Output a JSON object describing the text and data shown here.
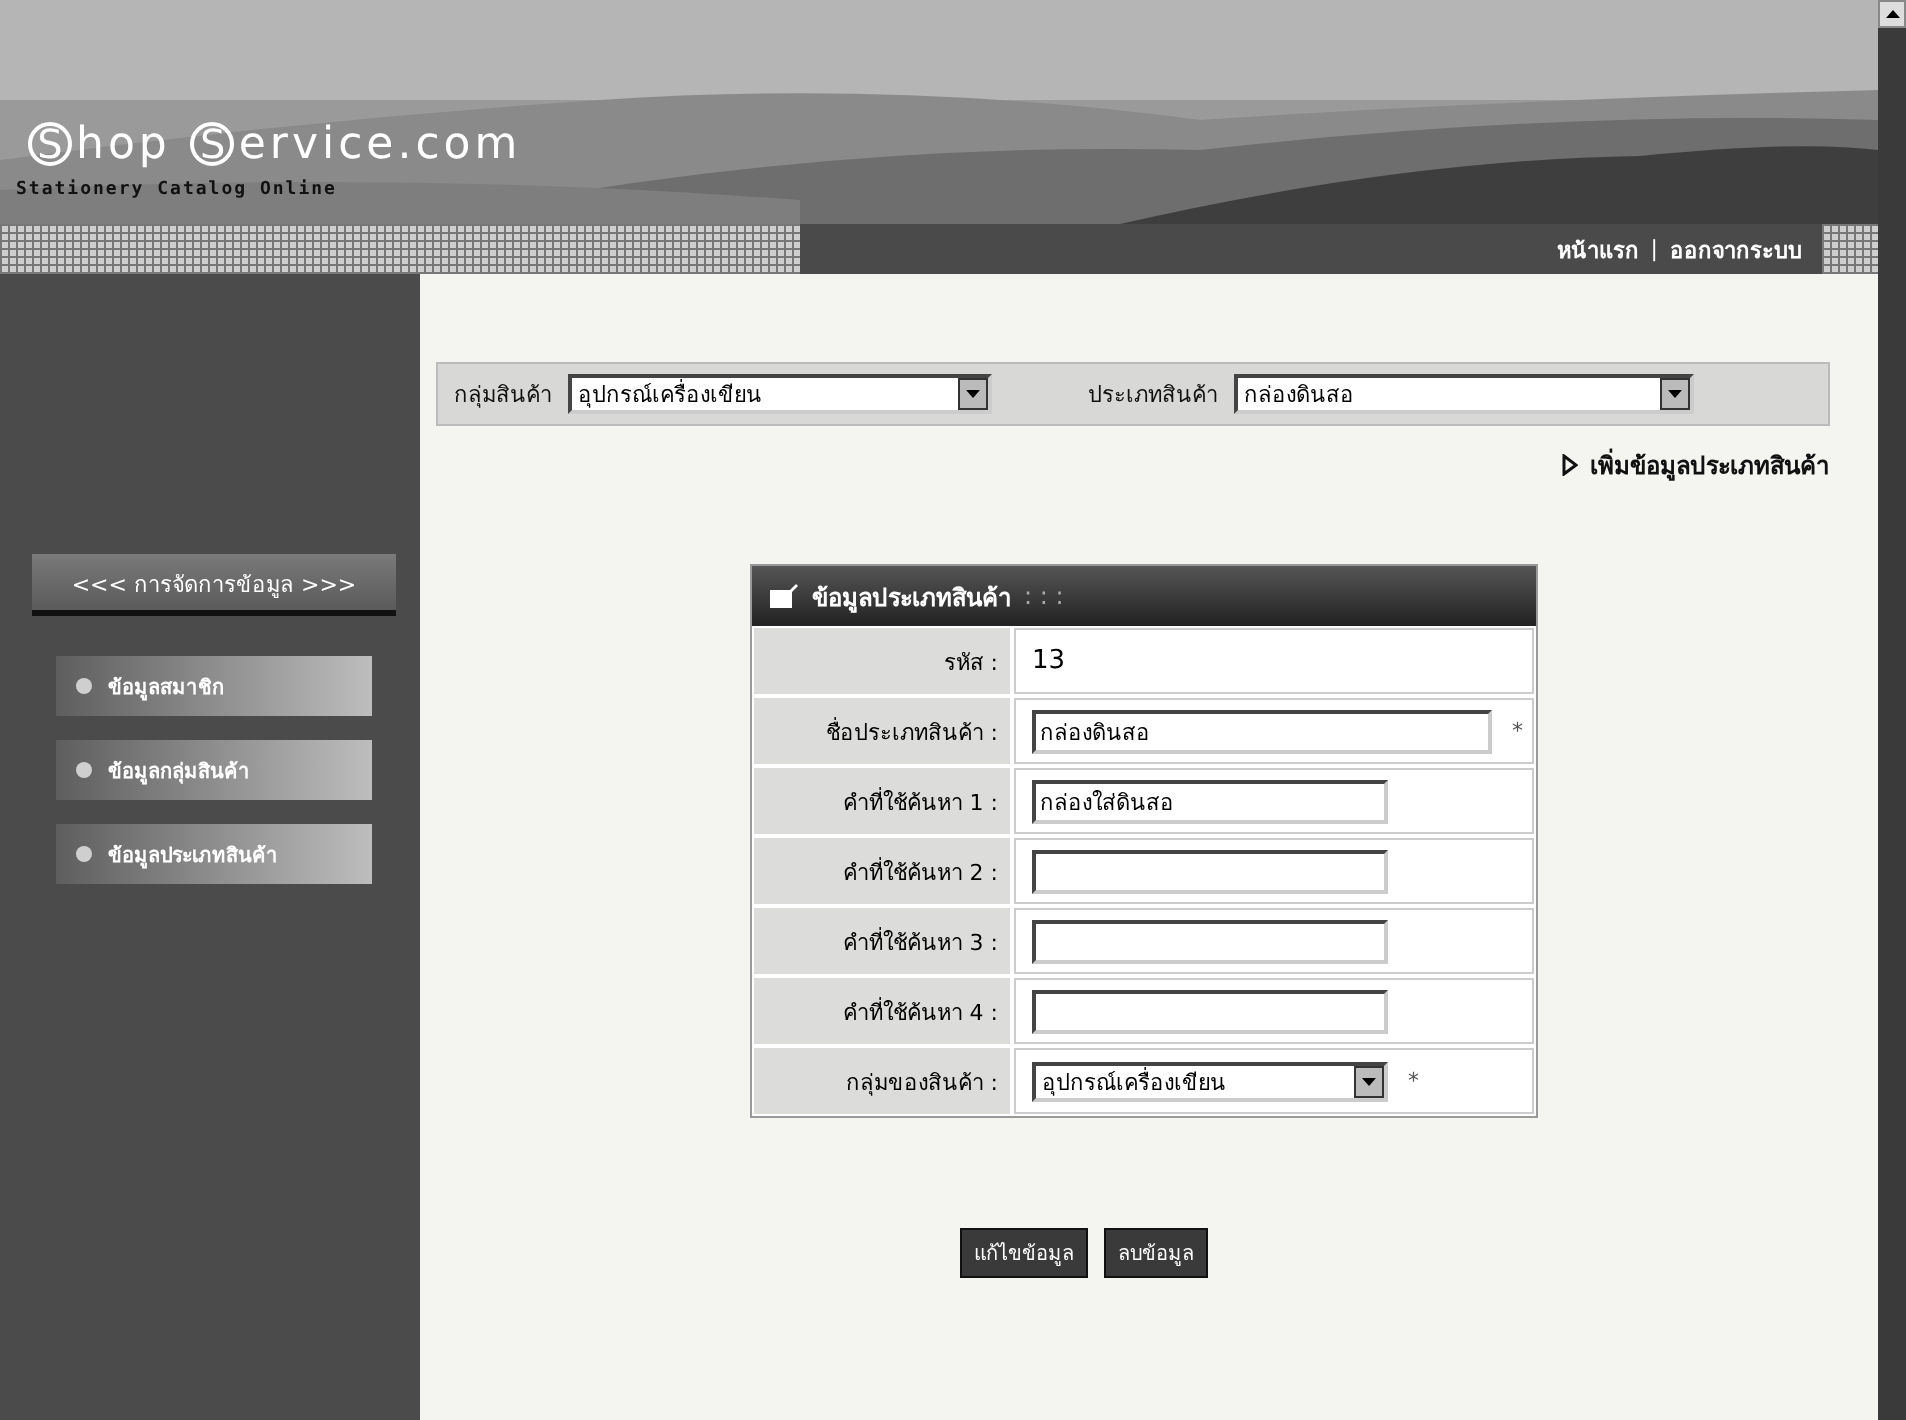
{
  "header": {
    "logo": [
      {
        "text": "S",
        "kind": "initial"
      },
      {
        "text": "hop",
        "kind": "rest"
      },
      {
        "text": "S",
        "kind": "initial"
      },
      {
        "text": "ervice.com",
        "kind": "rest"
      }
    ],
    "tagline": "Stationery Catalog Online",
    "nav_links": [
      "หน้าแรก",
      "ออกจากระบบ"
    ],
    "nav_separator": "|"
  },
  "sidebar": {
    "title": "<<< การจัดการข้อมูล >>>",
    "items": [
      {
        "label": "ข้อมูลสมาชิก"
      },
      {
        "label": "ข้อมูลกลุ่มสินค้า"
      },
      {
        "label": "ข้อมูลประเภทสินค้า"
      }
    ]
  },
  "filter_bar": {
    "filters": [
      {
        "label": "กลุ่มสินค้า",
        "value": "อุปกรณ์เครื่องเขียน"
      },
      {
        "label": "ประเภทสินค้า",
        "value": "กล่องดินสอ"
      }
    ]
  },
  "add_link": "เพิ่มข้อมูลประเภทสินค้า",
  "form": {
    "title": "ข้อมูลประเภทสินค้า",
    "title_suffix": ": : :",
    "rows": [
      {
        "label": "รหัส :",
        "kind": "text",
        "value": "13"
      },
      {
        "label": "ชื่อประเภทสินค้า :",
        "kind": "input",
        "value": "กล่องดินสอ",
        "wide": true,
        "mark": "*"
      },
      {
        "label": "คำที่ใช้ค้นหา 1 :",
        "kind": "input",
        "value": "กล่องใส่ดินสอ",
        "wide": false
      },
      {
        "label": "คำที่ใช้ค้นหา 2 :",
        "kind": "input",
        "wide": false
      },
      {
        "label": "คำที่ใช้ค้นหา 3 :",
        "kind": "input",
        "wide": false
      },
      {
        "label": "คำที่ใช้ค้นหา 4 :",
        "kind": "input",
        "wide": false
      },
      {
        "label": "กลุ่มของสินค้า :",
        "kind": "select",
        "value": "อุปกรณ์เครื่องเขียน",
        "mark": "*"
      }
    ]
  },
  "buttons": [
    "แก้ไขข้อมูล",
    "ลบข้อมูล"
  ]
}
